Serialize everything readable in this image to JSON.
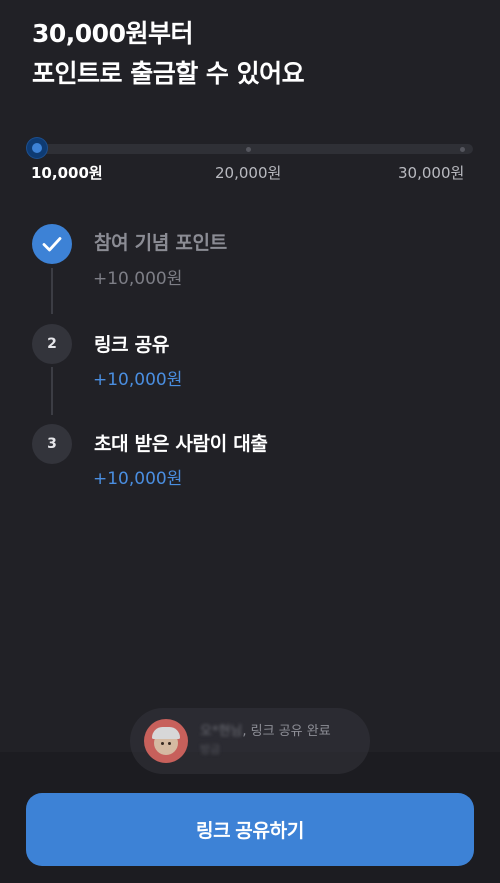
{
  "headline": {
    "line1": "30,000원부터",
    "line2": "포인트로 출금할 수 있어요"
  },
  "progress": {
    "current_value": 10000,
    "ticks": [
      "10,000원",
      "20,000원",
      "30,000원"
    ]
  },
  "steps": [
    {
      "marker": "✓",
      "title": "참여 기념 포인트",
      "amount": "+10,000원",
      "completed": true
    },
    {
      "marker": "2",
      "title": "링크 공유",
      "amount": "+10,000원",
      "completed": false
    },
    {
      "marker": "3",
      "title": "초대 받은 사람이 대출",
      "amount": "+10,000원",
      "completed": false
    }
  ],
  "toast": {
    "name": "오*현님",
    "message": ", 링크 공유 완료",
    "sub": "방금"
  },
  "cta": {
    "label": "링크 공유하기"
  },
  "colors": {
    "background": "#212126",
    "accent": "#3d82d6",
    "amount": "#4a8ee0",
    "muted": "#8b8c94"
  }
}
